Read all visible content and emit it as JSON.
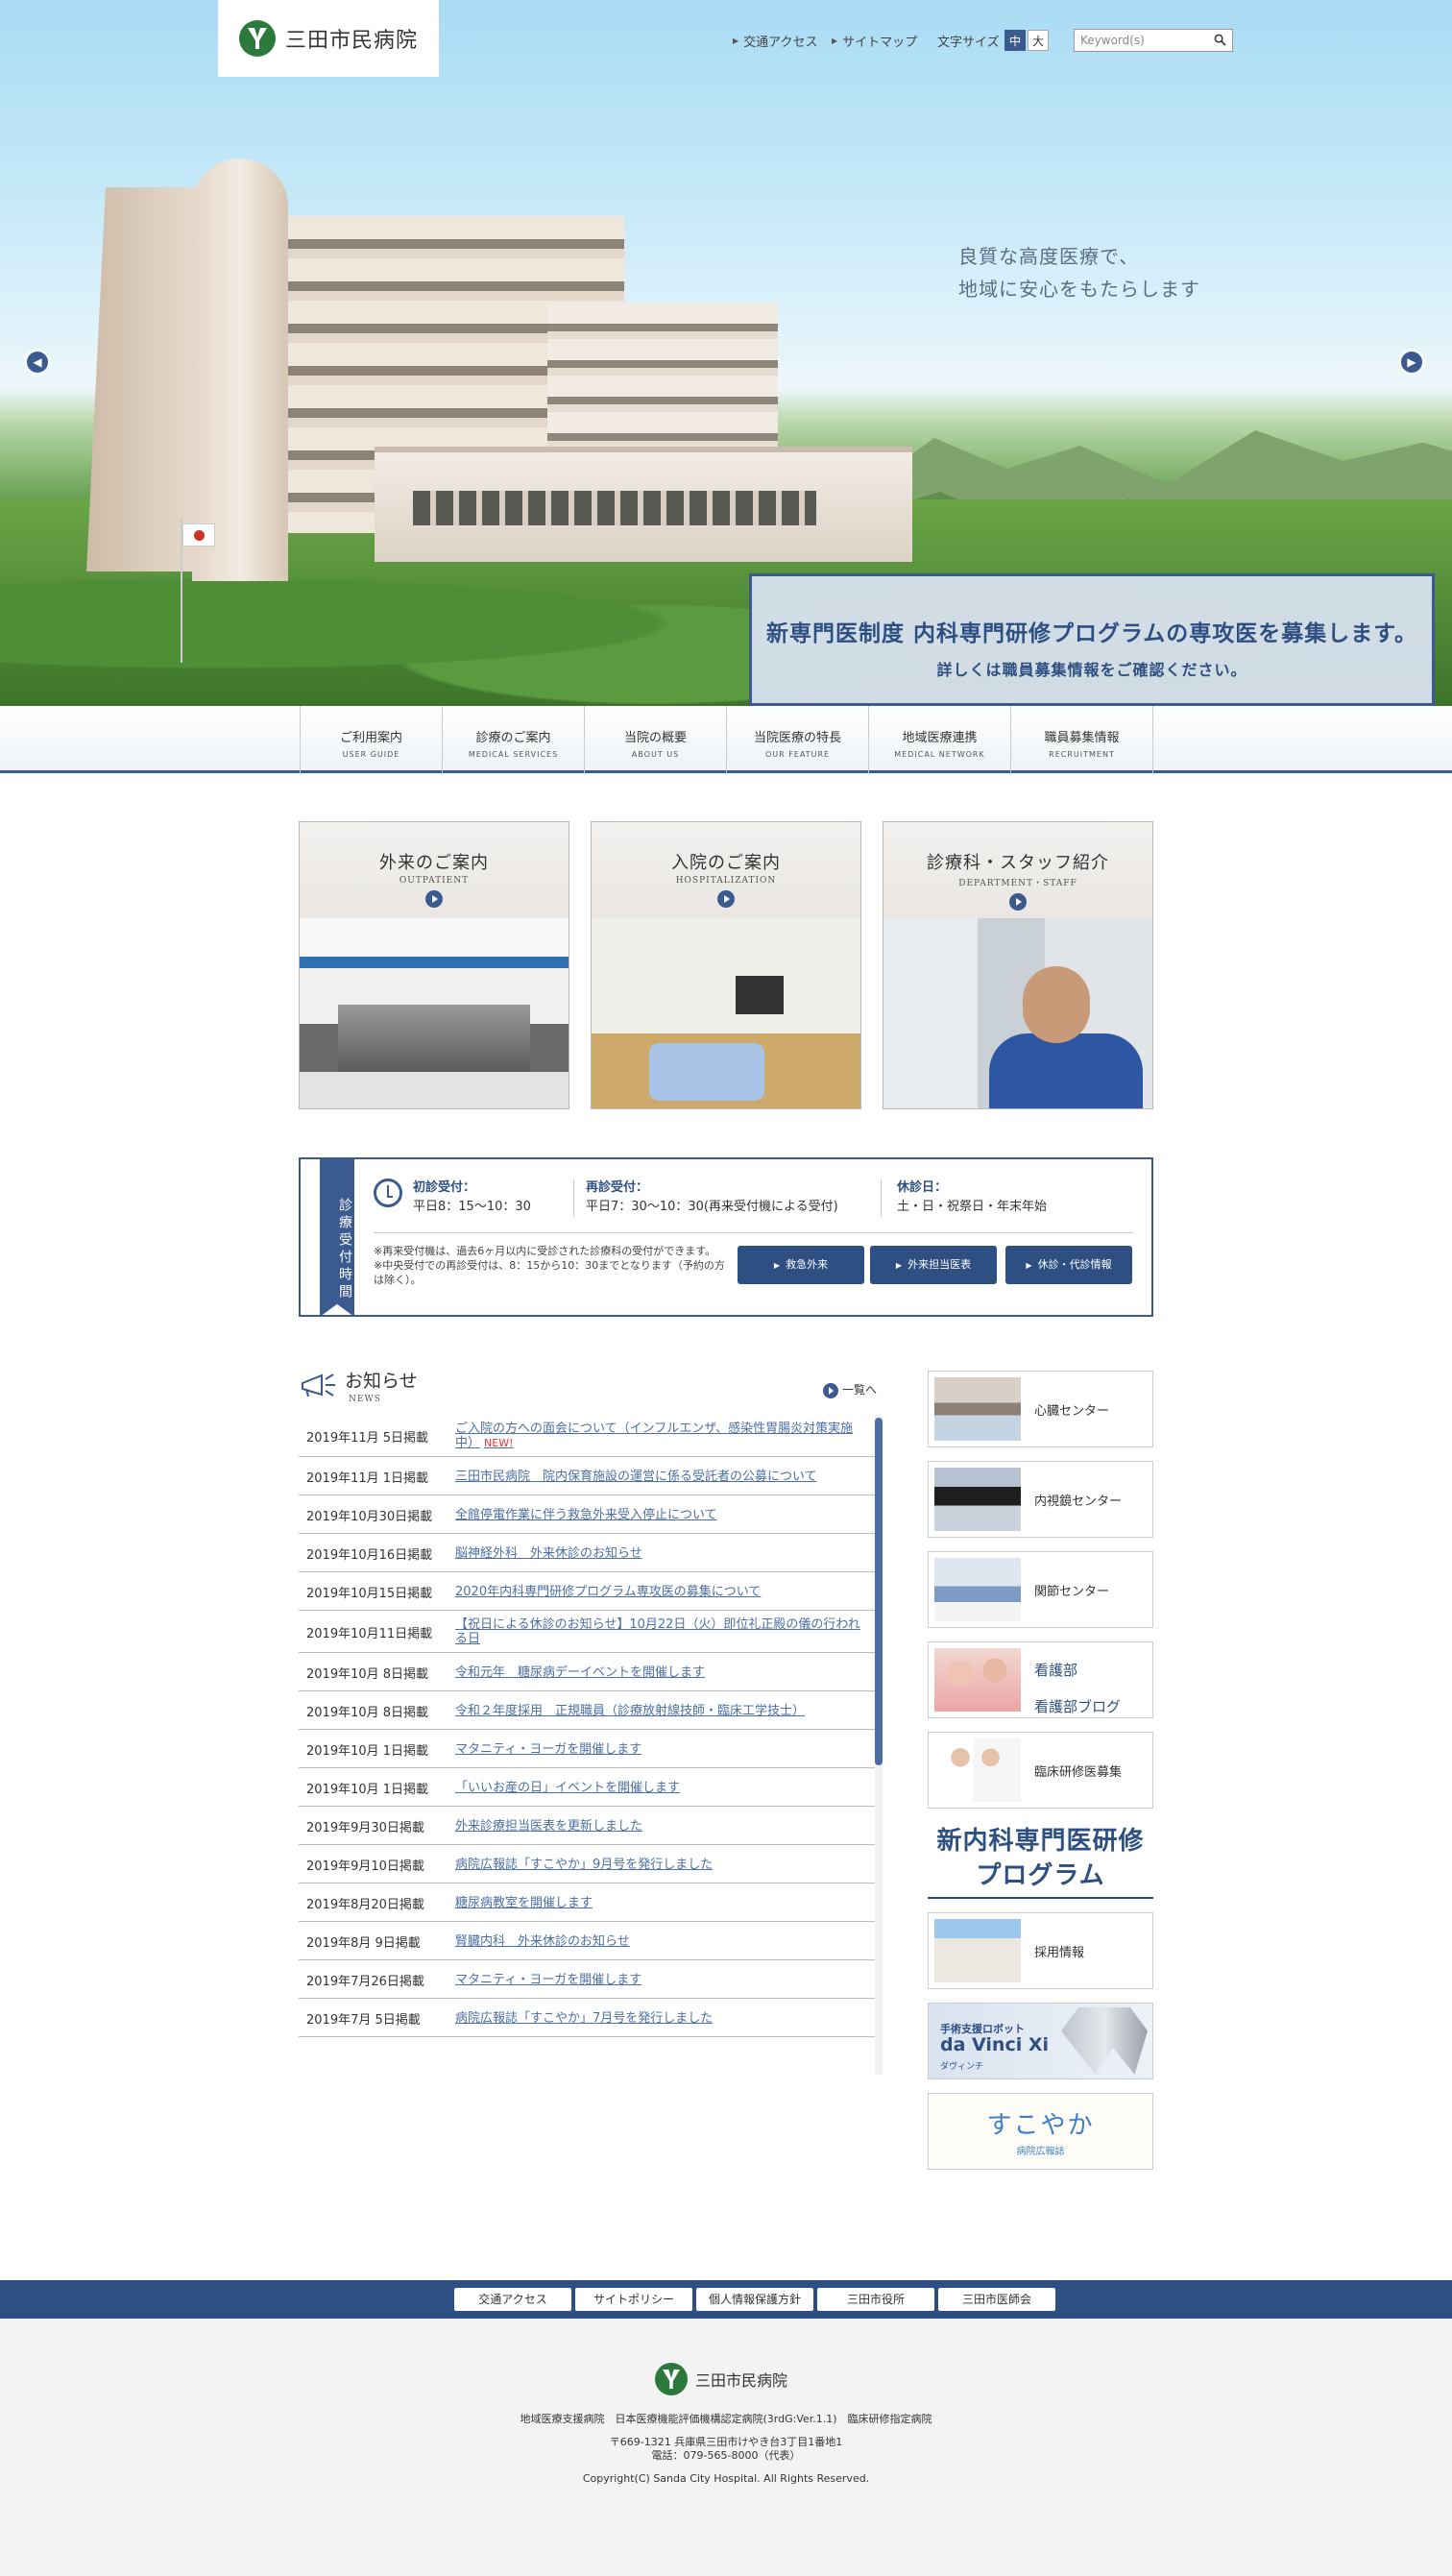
{
  "header": {
    "logo_text": "三田市民病院",
    "links": [
      "交通アクセス",
      "サイトマップ"
    ],
    "font_size_label": "文字サイズ",
    "font_size_options": [
      "中",
      "大"
    ],
    "search_placeholder": "Keyword(s)"
  },
  "hero": {
    "tagline_1": "良質な高度医療で、",
    "tagline_2": "地域に安心をもたらします",
    "recruit_line_1": "新専門医制度 内科専門研修プログラムの専攻医を募集します。",
    "recruit_line_2": "詳しくは職員募集情報をご確認ください。"
  },
  "gnav": [
    {
      "jp": "ご利用案内",
      "en": "USER GUIDE"
    },
    {
      "jp": "診療のご案内",
      "en": "MEDICAL SERVICES"
    },
    {
      "jp": "当院の概要",
      "en": "ABOUT US"
    },
    {
      "jp": "当院医療の特長",
      "en": "OUR FEATURE"
    },
    {
      "jp": "地域医療連携",
      "en": "MEDICAL NETWORK"
    },
    {
      "jp": "職員募集情報",
      "en": "RECRUITMENT"
    }
  ],
  "cards": [
    {
      "jp": "外来のご案内",
      "en": "OUTPATIENT"
    },
    {
      "jp": "入院のご案内",
      "en": "HOSPITALIZATION"
    },
    {
      "jp": "診療科・スタッフ紹介",
      "en": "DEPARTMENT・STAFF"
    }
  ],
  "hours": {
    "tag": "診療受付時間",
    "first_label": "初診受付：",
    "first_value": "平日8：15〜10：30",
    "return_label": "再診受付：",
    "return_value": "平日7：30〜10：30(再来受付機による受付)",
    "closed_label": "休診日：",
    "closed_value": "土・日・祝祭日・年末年始",
    "note_1": "※再来受付機は、過去6ヶ月以内に受診された診療科の受付ができます。",
    "note_2": "※中央受付での再診受付は、8：15から10：30までとなります（予約の方は除く）。",
    "buttons": [
      "救急外来",
      "外来担当医表",
      "休診・代診情報"
    ]
  },
  "news": {
    "title": "お知らせ",
    "sub": "NEWS",
    "more": "一覧へ",
    "new_label": "NEW!",
    "items": [
      {
        "date": "2019年11月 5日掲載",
        "title": "ご入院の方への面会について（インフルエンザ、感染性胃腸炎対策実施中）",
        "new": true
      },
      {
        "date": "2019年11月 1日掲載",
        "title": "三田市民病院　院内保育施設の運営に係る受託者の公募について"
      },
      {
        "date": "2019年10月30日掲載",
        "title": "全館停電作業に伴う救急外来受入停止について"
      },
      {
        "date": "2019年10月16日掲載",
        "title": "脳神経外科　外来休診のお知らせ"
      },
      {
        "date": "2019年10月15日掲載",
        "title": "2020年内科専門研修プログラム専攻医の募集について"
      },
      {
        "date": "2019年10月11日掲載",
        "title": "【祝日による休診のお知らせ】10月22日（火）即位礼正殿の儀の行われる日"
      },
      {
        "date": "2019年10月 8日掲載",
        "title": "令和元年　糖尿病デーイベントを開催します"
      },
      {
        "date": "2019年10月 8日掲載",
        "title": "令和２年度採用　正規職員（診療放射線技師・臨床工学技士）"
      },
      {
        "date": "2019年10月 1日掲載",
        "title": "マタニティ・ヨーガを開催します"
      },
      {
        "date": "2019年10月 1日掲載",
        "title": "「いいお産の日」イベントを開催します"
      },
      {
        "date": "2019年9月30日掲載",
        "title": "外来診療担当医表を更新しました"
      },
      {
        "date": "2019年9月10日掲載",
        "title": "病院広報誌「すこやか」9月号を発行しました"
      },
      {
        "date": "2019年8月20日掲載",
        "title": "糖尿病教室を開催します"
      },
      {
        "date": "2019年8月 9日掲載",
        "title": "腎臓内科　外来休診のお知らせ"
      },
      {
        "date": "2019年7月26日掲載",
        "title": "マタニティ・ヨーガを開催します"
      },
      {
        "date": "2019年7月 5日掲載",
        "title": "病院広報誌「すこやか」7月号を発行しました"
      }
    ]
  },
  "sidebar": {
    "heart": "心臓センター",
    "endoscopy": "内視鏡センター",
    "joint": "関節センター",
    "nursing_1": "看護部",
    "nursing_2": "看護部ブログ",
    "resident": "臨床研修医募集",
    "program_1": "新内科専門医研修",
    "program_2": "プログラム",
    "recruit": "採用情報",
    "davinci_1": "手術支援ロボット",
    "davinci_2": "da Vinci Xi",
    "davinci_3": "ダヴィンチ",
    "sukoyaka_1": "すこやか",
    "sukoyaka_2": "病院広報誌"
  },
  "footer": {
    "links": [
      "交通アクセス",
      "サイトポリシー",
      "個人情報保護方針",
      "三田市役所",
      "三田市医師会"
    ],
    "name": "三田市民病院",
    "certs": "地域医療支援病院　日本医療機能評価機構認定病院(3rdG:Ver.1.1)　臨床研修指定病院",
    "address": "〒669-1321 兵庫県三田市けやき台3丁目1番地1",
    "phone": "電話：079-565-8000（代表）",
    "copyright": "Copyright(C) Sanda City Hospital. All Rights Reserved."
  },
  "colors": {
    "brand": "#3b5a8f",
    "brand_dark": "#2e4f82",
    "logo_green": "#2c7a3b",
    "link": "#4c6fa6",
    "new": "#ee3333"
  }
}
